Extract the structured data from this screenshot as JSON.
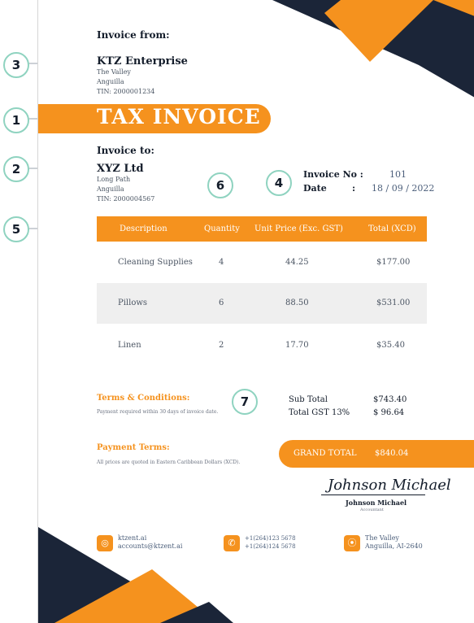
{
  "colors": {
    "accent": "#f5921e",
    "navy": "#1b2538",
    "teal": "#8fd3c0"
  },
  "from": {
    "heading": "Invoice from:",
    "company": "KTZ Enterprise",
    "address1": "The Valley",
    "address2": "Anguilla",
    "tin": "TIN: 2000001234"
  },
  "title": "TAX INVOICE",
  "to": {
    "heading": "Invoice to:",
    "company": "XYZ Ltd",
    "address1": "Long Path",
    "address2": "Anguilla",
    "tin": "TIN: 2000004567"
  },
  "meta": {
    "no_label": "Invoice No :",
    "no_value": "101",
    "date_label": "Date",
    "date_colon": ":",
    "date_value": "18 / 09 / 2022"
  },
  "table": {
    "headers": [
      "Description",
      "Quantity",
      "Unit Price (Exc. GST)",
      "Total (XCD)"
    ],
    "rows": [
      {
        "description": "Cleaning Supplies",
        "quantity": "4",
        "unit_price": "44.25",
        "total": "$177.00"
      },
      {
        "description": "Pillows",
        "quantity": "6",
        "unit_price": "88.50",
        "total": "$531.00"
      },
      {
        "description": "Linen",
        "quantity": "2",
        "unit_price": "17.70",
        "total": "$35.40"
      }
    ]
  },
  "terms": {
    "heading": "Terms & Conditions:",
    "text": "Payment required within 30 days of invoice date."
  },
  "payment": {
    "heading": "Payment Terms:",
    "text": "All prices are quoted in Eastern Caribbean Dollars (XCD)."
  },
  "totals": {
    "subtotal_label": "Sub Total",
    "subtotal_value": "$743.40",
    "gst_label": "Total GST 13%",
    "gst_value": "$ 96.64",
    "grand_label": "GRAND TOTAL",
    "grand_value": "$840.04"
  },
  "signature": {
    "script": "Johnson Michael",
    "name": "Johnson Michael",
    "role": "Accountant"
  },
  "footer": {
    "web": "ktzent.ai",
    "email": "accounts@ktzent.ai",
    "phone1": "+1(264)123 5678",
    "phone2": "+1(264)124 5678",
    "addr1": "The Valley",
    "addr2": "Anguilla, AI-2640"
  },
  "callouts": [
    "1",
    "2",
    "3",
    "4",
    "5",
    "6",
    "7"
  ],
  "icons": {
    "web": "globe-icon",
    "phone": "phone-icon",
    "location": "location-pin-icon"
  }
}
